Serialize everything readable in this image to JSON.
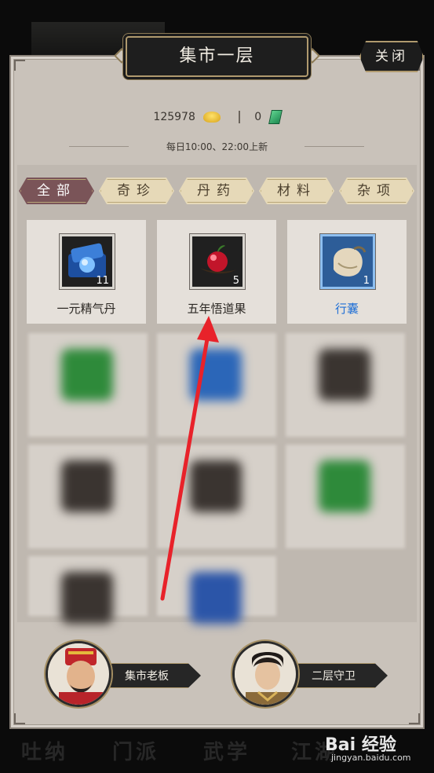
{
  "header": {
    "title": "集市一层",
    "close_label": "关闭"
  },
  "currency": {
    "gold": "125978",
    "jade": "0"
  },
  "refresh_note": "每日10:00、22:00上新",
  "tabs": [
    {
      "label": "全部",
      "active": true
    },
    {
      "label": "奇珍",
      "active": false
    },
    {
      "label": "丹药",
      "active": false
    },
    {
      "label": "材料",
      "active": false
    },
    {
      "label": "杂项",
      "active": false
    }
  ],
  "items": [
    {
      "name": "一元精气丹",
      "count": "11",
      "icon": "blue-pill-box-icon",
      "frame": "gray"
    },
    {
      "name": "五年悟道果",
      "count": "5",
      "icon": "red-fruit-icon",
      "frame": "gray"
    },
    {
      "name": "行囊",
      "count": "1",
      "icon": "cloth-bag-icon",
      "frame": "blue"
    }
  ],
  "npcs": [
    {
      "label": "集市老板",
      "icon": "merchant-avatar-icon"
    },
    {
      "label": "二层守卫",
      "icon": "guard-avatar-icon"
    }
  ],
  "bottom_nav": [
    "吐纳",
    "门派",
    "武学",
    "江湖"
  ],
  "watermark": {
    "brand": "Bai 经验",
    "url": "jingyan.baidu.com"
  }
}
